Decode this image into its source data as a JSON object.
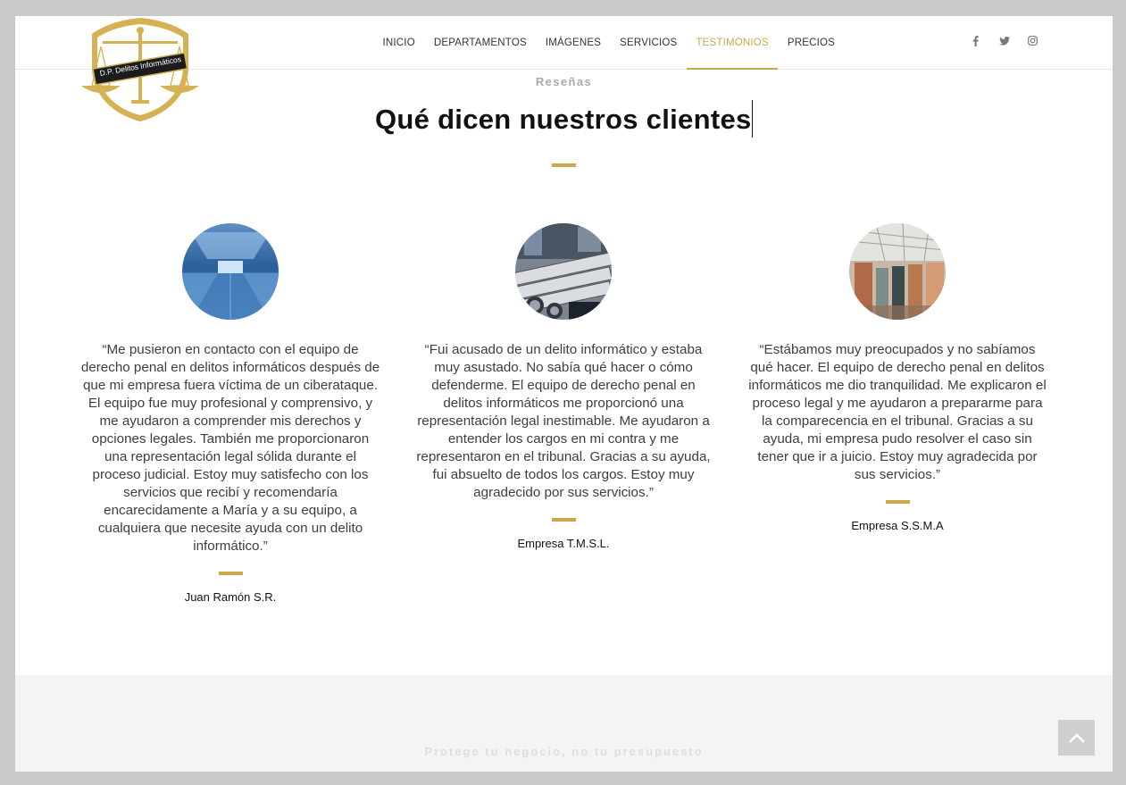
{
  "nav": {
    "items": [
      {
        "label": "INICIO",
        "active": false
      },
      {
        "label": "DEPARTAMENTOS",
        "active": false
      },
      {
        "label": "IMÁGENES",
        "active": false
      },
      {
        "label": "SERVICIOS",
        "active": false
      },
      {
        "label": "TESTIMONIOS",
        "active": true
      },
      {
        "label": "PRECIOS",
        "active": false
      }
    ],
    "social_icons": [
      "facebook-icon",
      "twitter-icon",
      "instagram-icon"
    ]
  },
  "logo": {
    "text": "D.P. Delitos Informáticos",
    "color": "#d4b254"
  },
  "section": {
    "eyebrow": "Reseñas",
    "title": "Qué dicen nuestros clientes"
  },
  "testimonials": [
    {
      "quote": "“Me pusieron en contacto con el equipo de derecho penal en delitos informáticos después de que mi empresa fuera víctima de un ciberataque. El equipo fue muy profesional y comprensivo, y me ayudaron a comprender mis derechos y opciones legales. También me proporcionaron una representación legal sólida durante el proceso judicial. Estoy muy satisfecho con los servicios que recibí y recomendaría encarecidamente a María y a su equipo, a cualquiera que necesite ayuda con un delito informático.”",
      "author": "Juan Ramón S.R.",
      "image": "warehouse-photo"
    },
    {
      "quote": "“Fui acusado de un delito informático y estaba muy asustado. No sabía qué hacer o cómo defenderme. El equipo de derecho penal en delitos informáticos me proporcionó una representación legal inestimable. Me ayudaron a entender los cargos en mi contra y me representaron en el tribunal. Gracias a su ayuda, fui absuelto de todos los cargos. Estoy muy agradecido por sus servicios.”",
      "author": "Empresa T.M.S.L.",
      "image": "pipes-factory-photo"
    },
    {
      "quote": "“Estábamos muy preocupados y no sabíamos qué hacer. El equipo de derecho penal en delitos informáticos me dio tranquilidad. Me explicaron el proceso legal y me ayudaron a prepararme para la comparecencia en el tribunal. Gracias a su ayuda, mi empresa pudo resolver el caso sin tener que ir a juicio. Estoy muy agradecida por sus servicios.”",
      "author": "Empresa S.S.M.A",
      "image": "factory-hall-photo"
    }
  ],
  "footer_band": {
    "text": "Protege tu negocio, no tu presupuesto"
  },
  "scroll_top": {
    "icon": "chevron-up-icon"
  },
  "colors": {
    "accent": "#c9a84c",
    "background": "#c9c9c9"
  }
}
